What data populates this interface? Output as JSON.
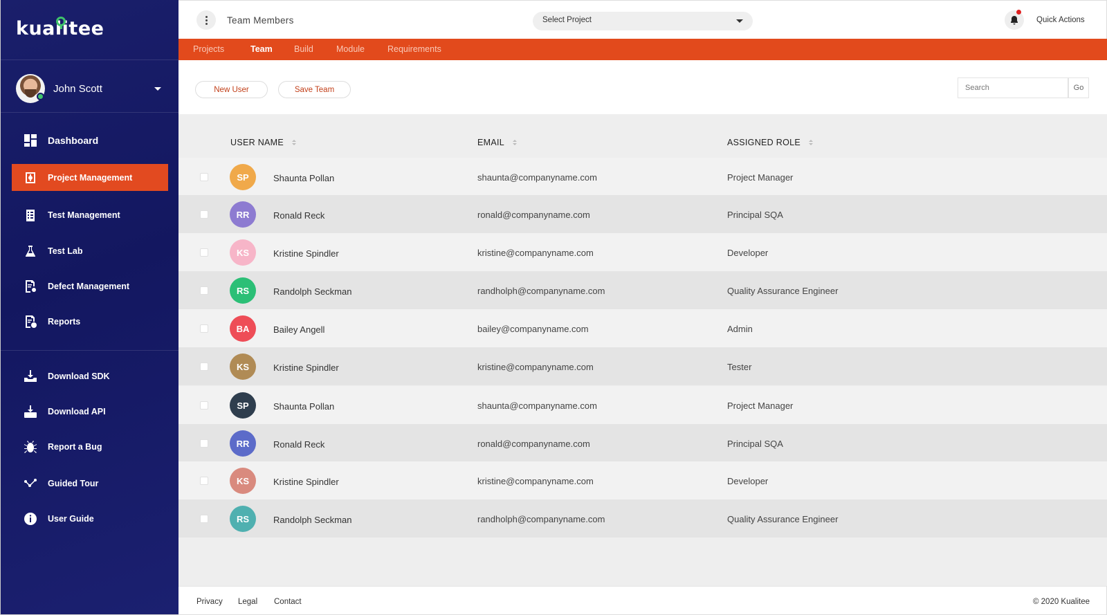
{
  "brand": {
    "name": "kualitee"
  },
  "user": {
    "name": "John Scott",
    "status": "online"
  },
  "sidebar": {
    "items": [
      {
        "label": "Dashboard",
        "icon": "dashboard-icon"
      },
      {
        "label": "Project Management",
        "icon": "project-management-icon",
        "active": true
      },
      {
        "label": "Test Management",
        "icon": "test-management-icon"
      },
      {
        "label": "Test Lab",
        "icon": "flask-icon"
      },
      {
        "label": "Defect Management",
        "icon": "defect-icon"
      },
      {
        "label": "Reports",
        "icon": "reports-icon"
      }
    ],
    "secondary": [
      {
        "label": "Download SDK",
        "icon": "download-sdk-icon"
      },
      {
        "label": "Download API",
        "icon": "download-api-icon"
      },
      {
        "label": "Report a Bug",
        "icon": "bug-icon"
      },
      {
        "label": "Guided Tour",
        "icon": "tour-icon"
      },
      {
        "label": "User Guide",
        "icon": "info-icon"
      }
    ]
  },
  "header": {
    "title": "Team Members",
    "project_select": "Select Project",
    "quick_actions": "Quick Actions"
  },
  "tabs": [
    {
      "label": "Projects"
    },
    {
      "label": "Team",
      "active": true
    },
    {
      "label": "Build"
    },
    {
      "label": "Module"
    },
    {
      "label": "Requirements"
    }
  ],
  "toolbar": {
    "new_user": "New User",
    "save_team": "Save Team",
    "search_placeholder": "Search",
    "go": "Go"
  },
  "table": {
    "columns": [
      "USER NAME",
      "EMAIL",
      "ASSIGNED ROLE"
    ],
    "rows": [
      {
        "initials": "SP",
        "name": "Shaunta Pollan",
        "email": "shaunta@companyname.com",
        "role": "Project Manager",
        "color": "#f0a94a"
      },
      {
        "initials": "RR",
        "name": "Ronald Reck",
        "email": "ronald@companyname.com",
        "role": "Principal SQA",
        "color": "#8d7bd1"
      },
      {
        "initials": "KS",
        "name": "Kristine Spindler",
        "email": "kristine@companyname.com",
        "role": "Developer",
        "color": "#f7b5c8"
      },
      {
        "initials": "RS",
        "name": "Randolph Seckman",
        "email": "randholph@companyname.com",
        "role": "Quality Assurance Engineer",
        "color": "#2bbf76"
      },
      {
        "initials": "BA",
        "name": "Bailey Angell",
        "email": "bailey@companyname.com",
        "role": "Admin",
        "color": "#ee4d57"
      },
      {
        "initials": "KS",
        "name": "Kristine Spindler",
        "email": "kristine@companyname.com",
        "role": "Tester",
        "color": "#b08b55"
      },
      {
        "initials": "SP",
        "name": "Shaunta Pollan",
        "email": "shaunta@companyname.com",
        "role": "Project Manager",
        "color": "#2f3e4e"
      },
      {
        "initials": "RR",
        "name": "Ronald Reck",
        "email": "ronald@companyname.com",
        "role": "Principal SQA",
        "color": "#5c6bc9"
      },
      {
        "initials": "KS",
        "name": "Kristine Spindler",
        "email": "kristine@companyname.com",
        "role": "Developer",
        "color": "#d98a7e"
      },
      {
        "initials": "RS",
        "name": "Randolph Seckman",
        "email": "randholph@companyname.com",
        "role": "Quality Assurance Engineer",
        "color": "#4fb0b0"
      }
    ]
  },
  "footer": {
    "links": [
      "Privacy",
      "Legal",
      "Contact"
    ],
    "copyright": "© 2020  Kualitee"
  },
  "colors": {
    "accent": "#e24a1c",
    "sidebar": "#161a66"
  }
}
